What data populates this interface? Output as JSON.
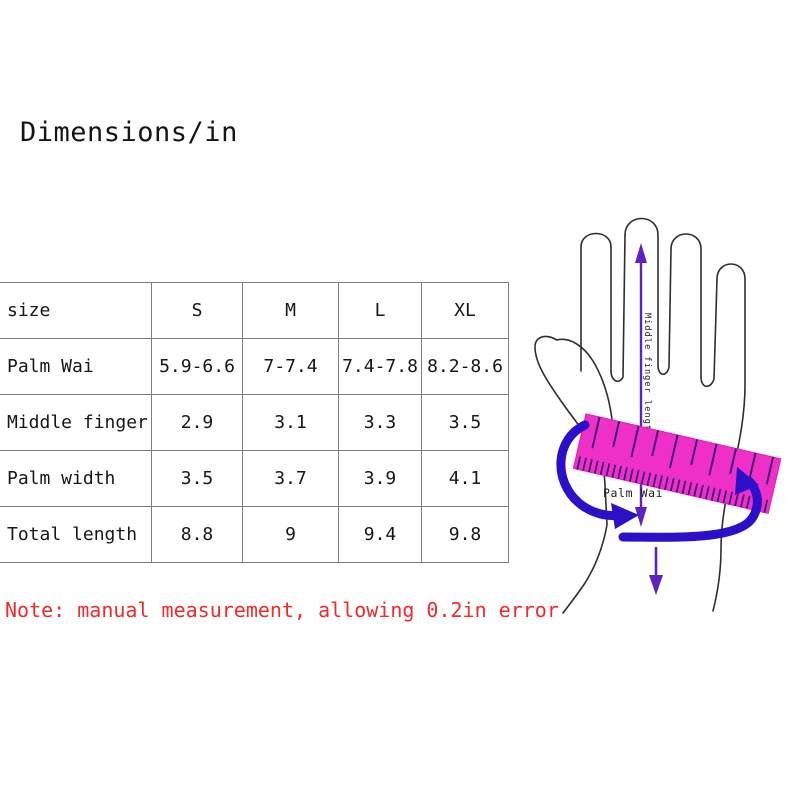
{
  "title": "Dimensions/in",
  "table": {
    "columns": [
      "size",
      "S",
      "M",
      "L",
      "XL"
    ],
    "rows": [
      {
        "label": "Palm Wai",
        "values": [
          "5.9-6.6",
          "7-7.4",
          "7.4-7.8",
          "8.2-8.6"
        ]
      },
      {
        "label": "Middle finger",
        "values": [
          "2.9",
          "3.1",
          "3.3",
          "3.5"
        ]
      },
      {
        "label": "Palm width",
        "values": [
          "3.5",
          "3.7",
          "3.9",
          "4.1"
        ]
      },
      {
        "label": "Total length",
        "values": [
          "8.8",
          "9",
          "9.4",
          "9.8"
        ]
      }
    ]
  },
  "note": "Note: manual measurement, allowing 0.2in error",
  "diagram": {
    "middle_finger_label": "Middle finger length",
    "palm_wai_label": "Palm Wai",
    "colors": {
      "arrow_purple": "#5b22c4",
      "arrow_blue": "#2a10c8",
      "ruler_pink": "#ee2fc8",
      "ruler_tick": "#3a1070",
      "hand_outline": "#2e2e2e"
    }
  },
  "colors": {
    "note_red": "#ef2a2a",
    "table_border": "#7d7d7d",
    "text": "#161616",
    "background": "#ffffff"
  }
}
